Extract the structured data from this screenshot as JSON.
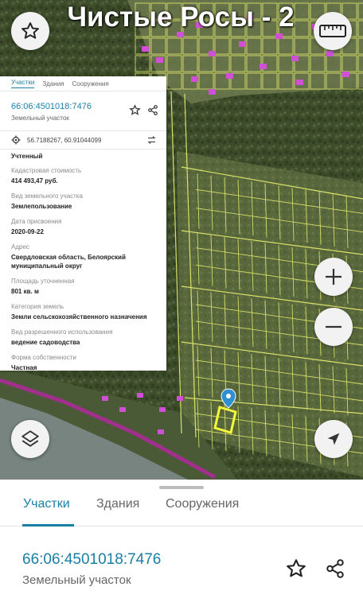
{
  "map": {
    "overlay_title": "Чистые Росы - 2",
    "colors": {
      "forest": "#3b4a2a",
      "parcel_outline": "#e9f070",
      "house_pink": "#d04fd6",
      "road_magenta": "#a0308c",
      "river": "#8a9496",
      "selected_parcel": "#f0f53a",
      "marker": "#2f8fd0"
    },
    "icons": {
      "favorite": "star-outline-icon",
      "ruler": "ruler-icon",
      "zoom_in": "plus-icon",
      "zoom_out": "minus-icon",
      "layers": "layers-icon",
      "locate": "navigation-arrow-icon",
      "marker": "map-pin-icon"
    }
  },
  "inset_card": {
    "tabs": [
      "Участки",
      "Здания",
      "Сооружения"
    ],
    "parcel_id": "66:06:4501018:7476",
    "parcel_type": "Земельный участок",
    "coordinates": "56.7188267, 60.91044099",
    "status": "Учтенный",
    "fields": [
      {
        "label": "Кадастровая стоимость",
        "value": "414 493,47 руб."
      },
      {
        "label": "Вид земельного участка",
        "value": "Землепользование"
      },
      {
        "label": "Дата присвоения",
        "value": "2020-09-22"
      },
      {
        "label": "Адрес",
        "value": "Свердловская область, Белоярский муниципальный округ"
      },
      {
        "label": "Площадь уточненная",
        "value": "801 кв. м"
      },
      {
        "label": "Категория земель",
        "value": "Земли сельскохозяйственного назначения"
      },
      {
        "label": "Вид разрешенного использования",
        "value": "ведение садоводства"
      },
      {
        "label": "Форма собственности",
        "value": "Частная"
      }
    ]
  },
  "sheet": {
    "tabs": [
      "Участки",
      "Здания",
      "Сооружения"
    ],
    "active_tab": "Участки",
    "parcel_id": "66:06:4501018:7476",
    "parcel_type": "Земельный участок"
  }
}
